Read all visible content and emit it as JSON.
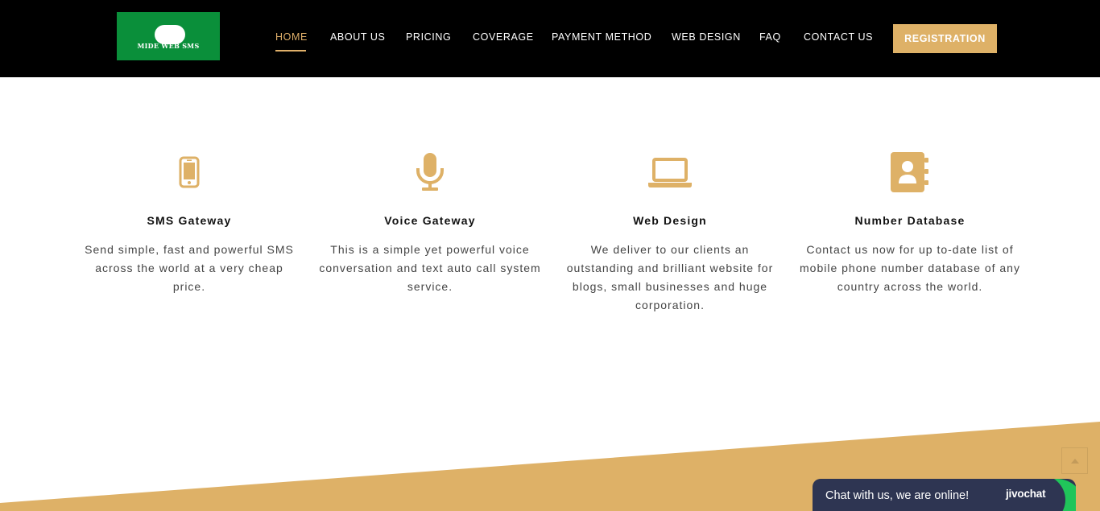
{
  "brand": {
    "logo_text": "MIDE WEB SMS",
    "logo_bg": "#0a8f3a"
  },
  "nav": {
    "items": [
      {
        "label": "HOME",
        "active": true
      },
      {
        "label": "ABOUT US"
      },
      {
        "label": "PRICING"
      },
      {
        "label": "COVERAGE"
      },
      {
        "label": "PAYMENT METHOD"
      },
      {
        "label": "WEB DESIGN"
      },
      {
        "label": "FAQ"
      },
      {
        "label": "CONTACT US"
      }
    ],
    "cta_label": "REGISTRATION"
  },
  "features": [
    {
      "icon": "mobile-phone-icon",
      "title": "SMS Gateway",
      "description": "Send simple, fast and powerful SMS across the world at a very cheap price."
    },
    {
      "icon": "microphone-icon",
      "title": "Voice Gateway",
      "description": "This is a simple yet powerful voice conversation and text auto call system service."
    },
    {
      "icon": "laptop-icon",
      "title": "Web Design",
      "description": "We deliver to our clients an outstanding and brilliant website for blogs, small businesses and huge corporation."
    },
    {
      "icon": "contact-book-icon",
      "title": "Number Database",
      "description": "Contact us now for up to-date list of mobile phone number database of any country across the world."
    }
  ],
  "chat": {
    "text": "Chat with us, we are online!",
    "brand": "jivochat"
  },
  "colors": {
    "accent": "#deb167",
    "header_bg": "#000000",
    "chat_bg": "#2e3552",
    "chat_green": "#20c55a"
  }
}
